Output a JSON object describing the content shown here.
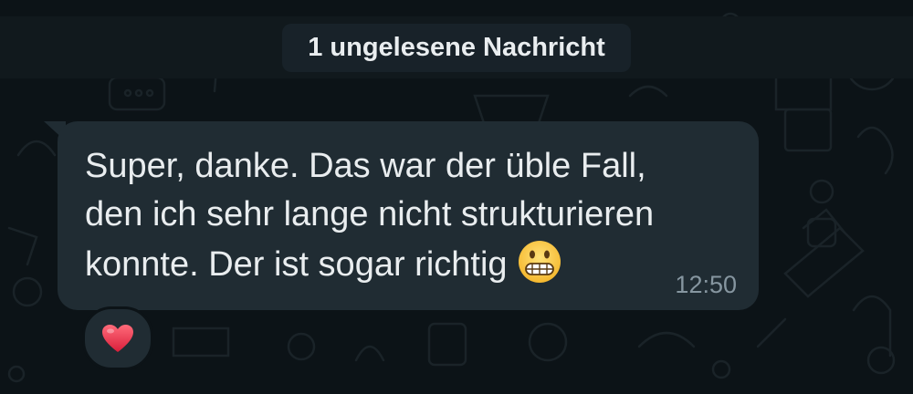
{
  "banner": {
    "text": "1 ungelesene Nachricht"
  },
  "message": {
    "lines": [
      "Super, danke. Das war der üble Fall,",
      "den ich sehr lange nicht strukturieren",
      "konnte. Der ist sogar richtig"
    ],
    "emoji": "grimacing-face-icon",
    "time": "12:50"
  },
  "reaction": {
    "icon": "heart-icon",
    "color": "#e0245e"
  },
  "colors": {
    "background": "#0c1317",
    "bubble": "#202c33",
    "text": "#e9edef",
    "meta": "#8696a0"
  }
}
